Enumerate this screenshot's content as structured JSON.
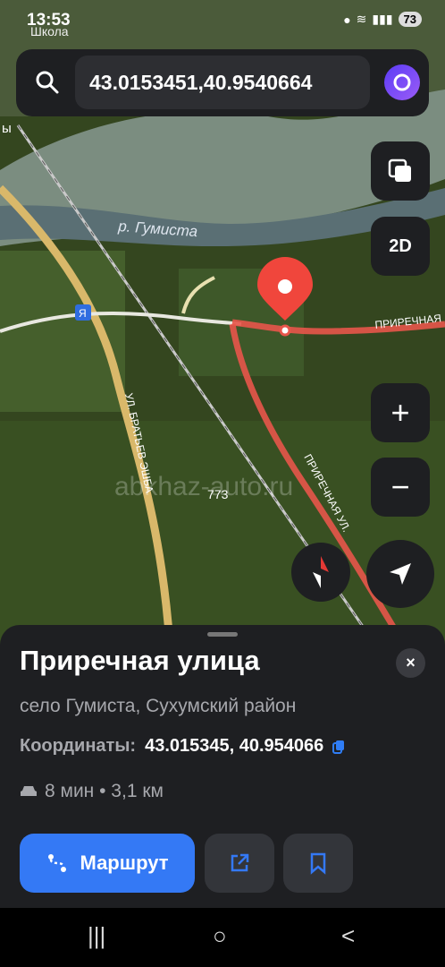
{
  "status": {
    "time": "13:53",
    "subtitle": "Школа",
    "battery": "73"
  },
  "search": {
    "query": "43.0153451,40.9540664"
  },
  "map": {
    "river_label": "р. Гумиста",
    "street_label_1": "ПРИРЕЧНАЯ",
    "street_label_2": "ПРИРЕЧНАЯ УЛ.",
    "street_label_3": "УЛ. БРАТЬЕВ ЭШБА",
    "house_number": "773",
    "watermark": "abkhaz-auto.ru",
    "partial_label": "ы",
    "badge_text": "Я",
    "mode_2d": "2D",
    "zoom_in": "+",
    "zoom_out": "−",
    "colors": {
      "pin": "#f0463c",
      "road": "#e8554a"
    }
  },
  "card": {
    "title": "Приречная улица",
    "subtitle": "село Гумиста, Сухумский район",
    "coords_label": "Координаты:",
    "coords_value": "43.015345, 40.954066",
    "eta": "8 мин • 3,1 км",
    "route_button": "Маршрут",
    "close": "×"
  },
  "navbar": {
    "recent": "|||",
    "home": "○",
    "back": "<"
  }
}
